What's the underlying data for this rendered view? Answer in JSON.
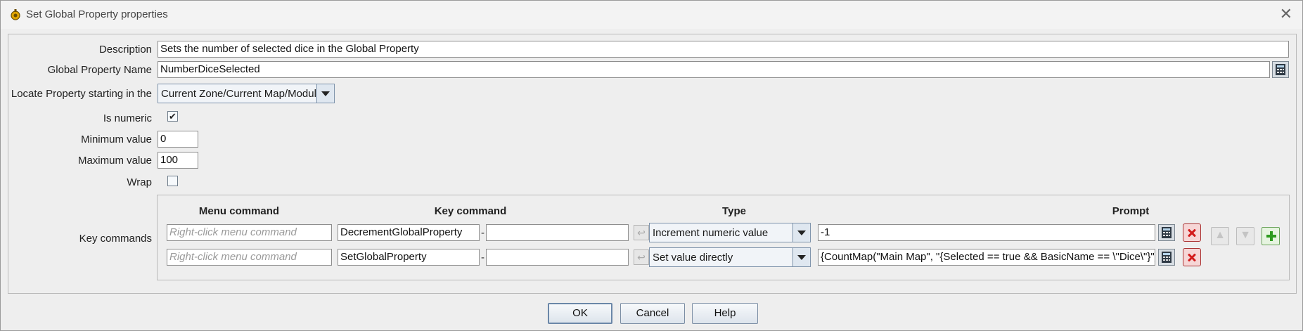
{
  "window": {
    "title": "Set Global Property properties"
  },
  "form": {
    "description_label": "Description",
    "description_value": "Sets the number of selected dice in the Global Property",
    "property_name_label": "Global Property Name",
    "property_name_value": "NumberDiceSelected",
    "locate_label": "Locate Property starting in the",
    "locate_value": "Current Zone/Current Map/Module",
    "is_numeric_label": "Is numeric",
    "is_numeric_checked": true,
    "is_numeric_mark": "✔",
    "min_label": "Minimum value",
    "min_value": "0",
    "max_label": "Maximum value",
    "max_value": "100",
    "wrap_label": "Wrap",
    "wrap_checked": false
  },
  "key_commands": {
    "label": "Key commands",
    "headers": {
      "menu": "Menu command",
      "key": "Key command",
      "type": "Type",
      "prompt": "Prompt"
    },
    "menu_placeholder": "Right-click menu command",
    "rows": [
      {
        "menu": "",
        "key": "DecrementGlobalProperty",
        "keystroke": "",
        "type": "Increment numeric value",
        "prompt": "-1"
      },
      {
        "menu": "",
        "key": "SetGlobalProperty",
        "keystroke": "",
        "type": "Set value directly",
        "prompt": "{CountMap(\"Main Map\", \"{Selected == true && BasicName == \\\"Dice\\\"}\")}"
      }
    ]
  },
  "buttons": {
    "ok": "OK",
    "cancel": "Cancel",
    "help": "Help"
  },
  "icons": {
    "title": "dice-app-icon",
    "close": "close-icon",
    "calc": "calculator-icon",
    "delete": "delete-icon",
    "up": "move-up-icon",
    "down": "move-down-icon",
    "add": "add-icon",
    "undo": "undo-icon"
  }
}
